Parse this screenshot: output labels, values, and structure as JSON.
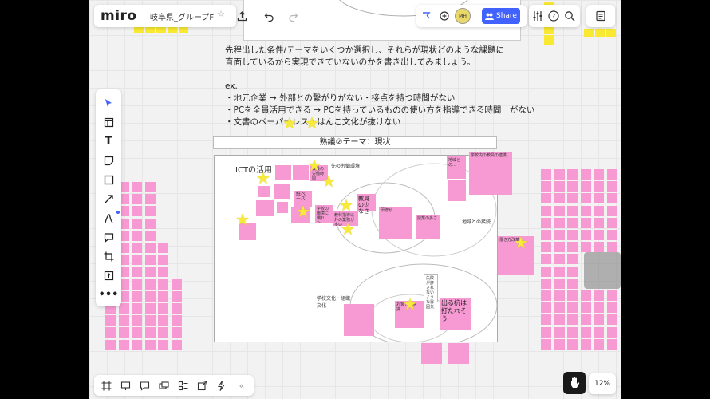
{
  "app": {
    "logo": "miro",
    "board_title": "岐阜県_グループF"
  },
  "topbar": {
    "share_label": "Share",
    "avatar_initials": "MH"
  },
  "zoom": {
    "level": "12%"
  },
  "instructions": {
    "line1": "先程出した条件/テーマをいくつか選択し、それらが現状どのような課題に",
    "line2": "直面しているから実現できていないのかを書き出してみましょう。",
    "ex": "ex.",
    "bullet1": "・地元企業 → 外部との繋がりがない・接点を持つ時間がない",
    "bullet2": "・PCを全員活用できる → PCを持っているものの使い方を指導できる時間　がない",
    "bullet3": "・文書のペーパーレス・はんこ文化が抜けない"
  },
  "section": {
    "header": "熟議②テーマ：現状"
  },
  "board": {
    "ict_label": "ICTの活用",
    "work_env_label": "先の労働環境",
    "teacher_shortage": "教員の少なさ",
    "region_label": "地域との接続",
    "school_culture_label": "学校文化・組織文化",
    "deru_kui": "出る杭は打たれそう",
    "small_notes": {
      "n1": "教員の労働時間",
      "n2": "紙ベース",
      "n3": "教科指導以外の業務が多い",
      "n4": "学校の環境に慣れた...",
      "n5": "研修が...",
      "n6": "授業の多さ",
      "n7": "失敗が許されないような雰囲気",
      "n8": "お客さん意識...",
      "n9": "地域との...",
      "n10": "働き方改革...",
      "n11": "学校内の教員の連携..."
    }
  },
  "toolbar_left": {
    "tools": [
      "select-icon",
      "frame-icon",
      "text-icon",
      "sticky-note-icon",
      "shape-icon",
      "connector-icon",
      "pen-icon",
      "comment-icon",
      "crop-icon",
      "upload-icon",
      "more-icon"
    ]
  }
}
